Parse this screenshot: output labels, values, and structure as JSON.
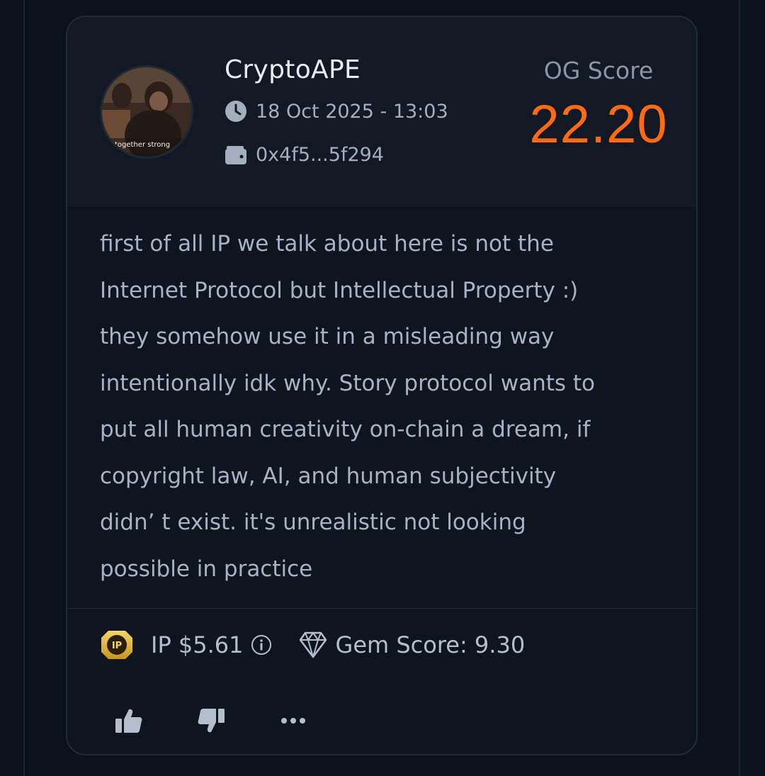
{
  "post": {
    "username": "CryptoAPE",
    "avatar_caption": "together strong",
    "date": "18 Oct 2025 - 13:03",
    "wallet": "0x4f5...5f294",
    "og_label": "OG Score",
    "og_value": "22.20",
    "body": "first of all IP we talk about here is not the\nInternet Protocol but Intellectual Property :)\nthey somehow use it in a misleading way\nintentionally idk why. Story protocol wants to\nput all human creativity on-chain a dream, if\ncopyright law, AI, and human subjectivity\ndidn’ t exist. it's unrealistic not looking\npossible in practice"
  },
  "stats": {
    "ip_price": "IP $5.61",
    "coin_text": "IP",
    "gem_score": "Gem Score: 9.30"
  },
  "icons": {
    "clock": "clock-icon",
    "wallet": "wallet-icon",
    "coin": "ip-coin-icon",
    "info": "info-icon",
    "gem": "gem-icon",
    "like": "thumbs-up-icon",
    "dislike": "thumbs-down-icon",
    "more": "more-icon"
  },
  "colors": {
    "accent": "#ff6a13",
    "background": "#0c121c",
    "card": "#0f151f",
    "text": "#a6b3c7"
  }
}
